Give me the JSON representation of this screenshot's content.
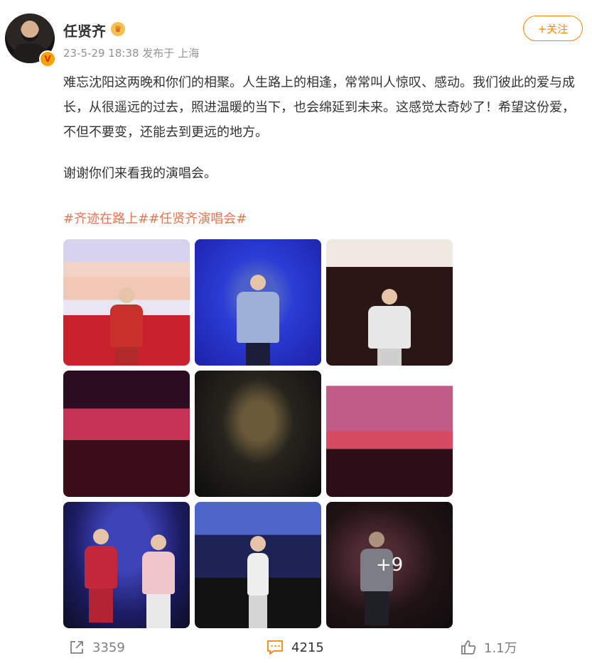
{
  "user": {
    "name": "任贤齐",
    "verified_badge": "V",
    "crown_icon": "crown-icon"
  },
  "post": {
    "meta": "23-5-29 18:38 发布于 上海",
    "follow_label": "+关注",
    "paragraph1": "难忘沈阳这两晚和你们的相聚。人生路上的相逢，常常叫人惊叹、感动。我们彼此的爱与成长，从很遥远的过去，照进温暖的当下，也会绵延到未来。这感觉太奇妙了！希望这份爱，不但不要变，还能去到更远的地方。",
    "paragraph2": "谢谢你们来看我的演唱会。",
    "hashtags": [
      "#齐迹在路上#",
      "#任贤齐演唱会#"
    ],
    "photo_overlay": "+9"
  },
  "actions": {
    "repost": "3359",
    "comment": "4215",
    "like": "1.1万"
  },
  "colors": {
    "accent": "#ff8200",
    "hashtag": "#eb7350",
    "meta_gray": "#939393"
  }
}
